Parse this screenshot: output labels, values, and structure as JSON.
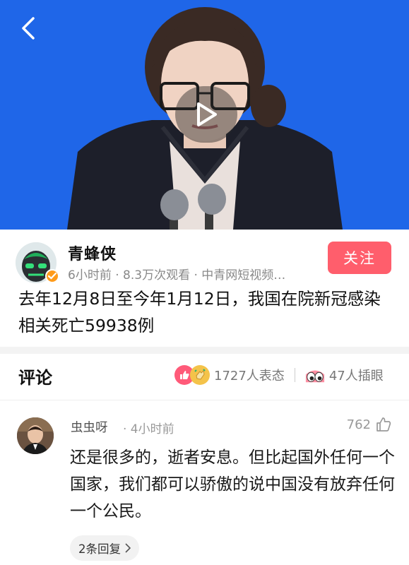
{
  "video": {
    "background_color": "#1f66e8",
    "back_icon": "chevron-left-icon",
    "play_icon": "play-icon"
  },
  "author": {
    "name": "青蜂侠",
    "meta": "6小时前 · 8.3万次观看 · 中青网短视频…",
    "follow_label": "关注",
    "follow_color": "#ff5e6c",
    "verified_badge_color": "#ff9b1a"
  },
  "post": {
    "title": "去年12月8日至今年1月12日，我国在院新冠感染相关死亡59938例"
  },
  "comments_section": {
    "title": "评论",
    "reaction_count": "1727人表态",
    "poke_count": "47人插眼"
  },
  "comments": [
    {
      "user": "虫虫呀",
      "time": "· 4小时前",
      "likes": "762",
      "text": "还是很多的，逝者安息。但比起国外任何一个国家，我们都可以骄傲的说中国没有放弃任何一个公民。",
      "replies_label": "2条回复"
    }
  ]
}
